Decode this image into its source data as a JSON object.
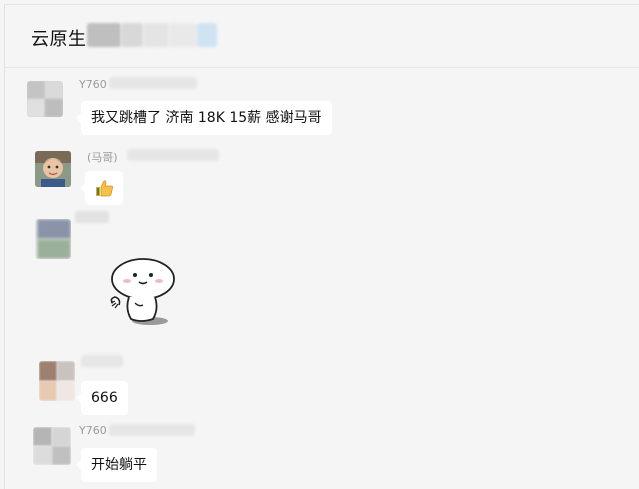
{
  "window": {
    "title": "云原生"
  },
  "messages": [
    {
      "sender": "Y760",
      "text": "我又跳槽了 济南 18K 15薪 感谢马哥"
    },
    {
      "sender": "(马哥)",
      "emoji": "thumbs-up-icon"
    },
    {
      "sender": "",
      "sticker": "cute-blob-sticker"
    },
    {
      "sender": "",
      "text": "666"
    },
    {
      "sender": "Y760",
      "text": "开始躺平"
    }
  ],
  "colors": {
    "background": "#f5f5f5",
    "bubble": "#ffffff",
    "sender_text": "#9a9a9a",
    "blur_gray": "#c9c9c9",
    "blur_blue": "#cfe3f3"
  }
}
